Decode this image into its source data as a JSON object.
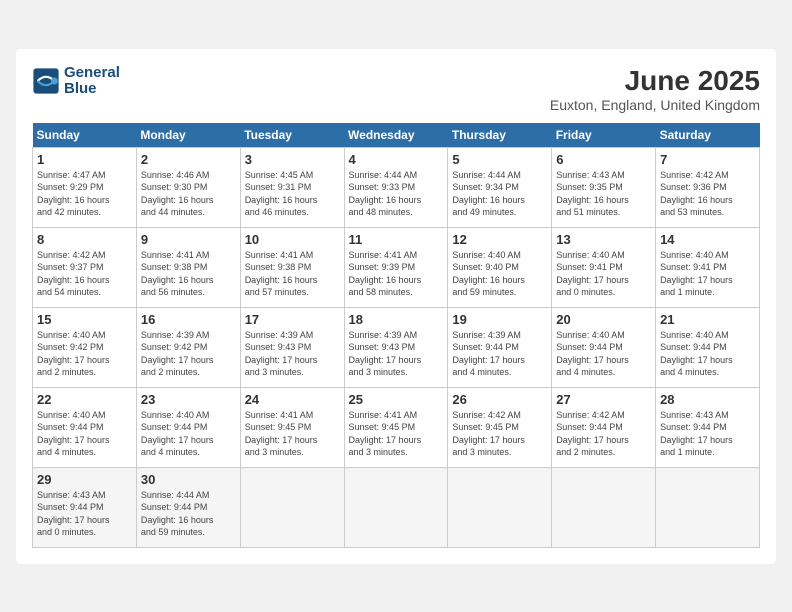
{
  "header": {
    "logo_line1": "General",
    "logo_line2": "Blue",
    "month": "June 2025",
    "location": "Euxton, England, United Kingdom"
  },
  "weekdays": [
    "Sunday",
    "Monday",
    "Tuesday",
    "Wednesday",
    "Thursday",
    "Friday",
    "Saturday"
  ],
  "weeks": [
    [
      {
        "day": "1",
        "info": "Sunrise: 4:47 AM\nSunset: 9:29 PM\nDaylight: 16 hours\nand 42 minutes."
      },
      {
        "day": "2",
        "info": "Sunrise: 4:46 AM\nSunset: 9:30 PM\nDaylight: 16 hours\nand 44 minutes."
      },
      {
        "day": "3",
        "info": "Sunrise: 4:45 AM\nSunset: 9:31 PM\nDaylight: 16 hours\nand 46 minutes."
      },
      {
        "day": "4",
        "info": "Sunrise: 4:44 AM\nSunset: 9:33 PM\nDaylight: 16 hours\nand 48 minutes."
      },
      {
        "day": "5",
        "info": "Sunrise: 4:44 AM\nSunset: 9:34 PM\nDaylight: 16 hours\nand 49 minutes."
      },
      {
        "day": "6",
        "info": "Sunrise: 4:43 AM\nSunset: 9:35 PM\nDaylight: 16 hours\nand 51 minutes."
      },
      {
        "day": "7",
        "info": "Sunrise: 4:42 AM\nSunset: 9:36 PM\nDaylight: 16 hours\nand 53 minutes."
      }
    ],
    [
      {
        "day": "8",
        "info": "Sunrise: 4:42 AM\nSunset: 9:37 PM\nDaylight: 16 hours\nand 54 minutes."
      },
      {
        "day": "9",
        "info": "Sunrise: 4:41 AM\nSunset: 9:38 PM\nDaylight: 16 hours\nand 56 minutes."
      },
      {
        "day": "10",
        "info": "Sunrise: 4:41 AM\nSunset: 9:38 PM\nDaylight: 16 hours\nand 57 minutes."
      },
      {
        "day": "11",
        "info": "Sunrise: 4:41 AM\nSunset: 9:39 PM\nDaylight: 16 hours\nand 58 minutes."
      },
      {
        "day": "12",
        "info": "Sunrise: 4:40 AM\nSunset: 9:40 PM\nDaylight: 16 hours\nand 59 minutes."
      },
      {
        "day": "13",
        "info": "Sunrise: 4:40 AM\nSunset: 9:41 PM\nDaylight: 17 hours\nand 0 minutes."
      },
      {
        "day": "14",
        "info": "Sunrise: 4:40 AM\nSunset: 9:41 PM\nDaylight: 17 hours\nand 1 minute."
      }
    ],
    [
      {
        "day": "15",
        "info": "Sunrise: 4:40 AM\nSunset: 9:42 PM\nDaylight: 17 hours\nand 2 minutes."
      },
      {
        "day": "16",
        "info": "Sunrise: 4:39 AM\nSunset: 9:42 PM\nDaylight: 17 hours\nand 2 minutes."
      },
      {
        "day": "17",
        "info": "Sunrise: 4:39 AM\nSunset: 9:43 PM\nDaylight: 17 hours\nand 3 minutes."
      },
      {
        "day": "18",
        "info": "Sunrise: 4:39 AM\nSunset: 9:43 PM\nDaylight: 17 hours\nand 3 minutes."
      },
      {
        "day": "19",
        "info": "Sunrise: 4:39 AM\nSunset: 9:44 PM\nDaylight: 17 hours\nand 4 minutes."
      },
      {
        "day": "20",
        "info": "Sunrise: 4:40 AM\nSunset: 9:44 PM\nDaylight: 17 hours\nand 4 minutes."
      },
      {
        "day": "21",
        "info": "Sunrise: 4:40 AM\nSunset: 9:44 PM\nDaylight: 17 hours\nand 4 minutes."
      }
    ],
    [
      {
        "day": "22",
        "info": "Sunrise: 4:40 AM\nSunset: 9:44 PM\nDaylight: 17 hours\nand 4 minutes."
      },
      {
        "day": "23",
        "info": "Sunrise: 4:40 AM\nSunset: 9:44 PM\nDaylight: 17 hours\nand 4 minutes."
      },
      {
        "day": "24",
        "info": "Sunrise: 4:41 AM\nSunset: 9:45 PM\nDaylight: 17 hours\nand 3 minutes."
      },
      {
        "day": "25",
        "info": "Sunrise: 4:41 AM\nSunset: 9:45 PM\nDaylight: 17 hours\nand 3 minutes."
      },
      {
        "day": "26",
        "info": "Sunrise: 4:42 AM\nSunset: 9:45 PM\nDaylight: 17 hours\nand 3 minutes."
      },
      {
        "day": "27",
        "info": "Sunrise: 4:42 AM\nSunset: 9:44 PM\nDaylight: 17 hours\nand 2 minutes."
      },
      {
        "day": "28",
        "info": "Sunrise: 4:43 AM\nSunset: 9:44 PM\nDaylight: 17 hours\nand 1 minute."
      }
    ],
    [
      {
        "day": "29",
        "info": "Sunrise: 4:43 AM\nSunset: 9:44 PM\nDaylight: 17 hours\nand 0 minutes."
      },
      {
        "day": "30",
        "info": "Sunrise: 4:44 AM\nSunset: 9:44 PM\nDaylight: 16 hours\nand 59 minutes."
      },
      null,
      null,
      null,
      null,
      null
    ]
  ]
}
